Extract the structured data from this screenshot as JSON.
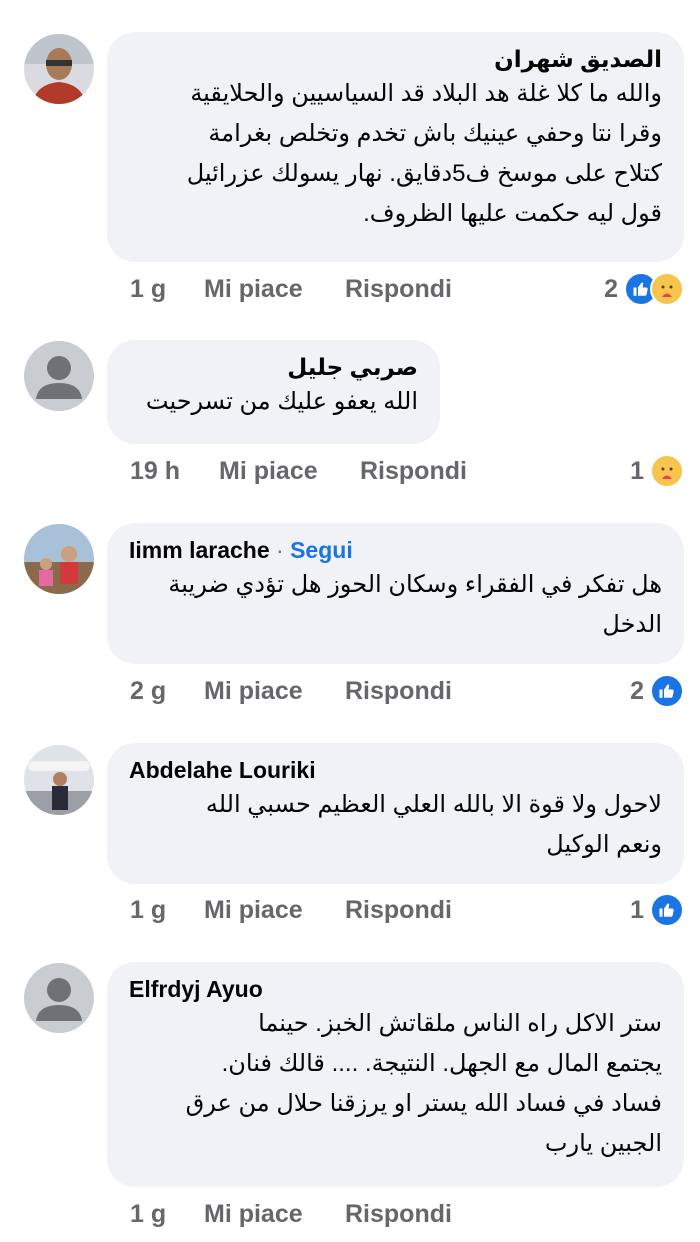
{
  "comments": [
    {
      "author": "الصديق شهران",
      "follow": "",
      "lines": [
        "والله ما كلا غلة هد البلاد قد السياسيين والحلايقية",
        "وقرا نتا وحفي عينيك باش تخدم وتخلص بغرامة",
        "كتلاح على موسخ ف5دقايق. نهار يسولك عزرائيل",
        "قول ليه حكمت عليها الظروف."
      ],
      "time": "1 g",
      "like_label": "Mi piace",
      "reply_label": "Rispondi",
      "reaction_count": "2",
      "reactions": [
        "like-icon",
        "care-icon"
      ]
    },
    {
      "author": "صربي جليل",
      "follow": "",
      "lines": [
        "الله يعفو عليك من تسرحيت"
      ],
      "time": "19 h",
      "like_label": "Mi piace",
      "reply_label": "Rispondi",
      "reaction_count": "1",
      "reactions": [
        "care-icon"
      ]
    },
    {
      "author": "Iimm larache",
      "follow": "Segui",
      "lines": [
        "هل تفكر في الفقراء وسكان الحوز هل تؤدي ضريبة",
        "الدخل"
      ],
      "time": "2 g",
      "like_label": "Mi piace",
      "reply_label": "Rispondi",
      "reaction_count": "2",
      "reactions": [
        "like-icon"
      ]
    },
    {
      "author": "Abdelahe Louriki",
      "follow": "",
      "lines": [
        "لاحول ولا قوة الا بالله العلي العظيم حسبي الله",
        "ونعم الوكيل"
      ],
      "time": "1 g",
      "like_label": "Mi piace",
      "reply_label": "Rispondi",
      "reaction_count": "1",
      "reactions": [
        "like-icon"
      ]
    },
    {
      "author": "Elfrdyj Ayuo",
      "follow": "",
      "lines": [
        "ستر الاكل راه الناس ملقاتش الخبز. حينما",
        "يجتمع المال مع الجهل. النتيجة. .... قالك فنان.",
        "فساد في فساد الله يستر او يرزقنا حلال من عرق",
        "الجبين يارب"
      ],
      "time": "1 g",
      "like_label": "Mi piace",
      "reply_label": "Rispondi",
      "reaction_count": "",
      "reactions": []
    }
  ]
}
